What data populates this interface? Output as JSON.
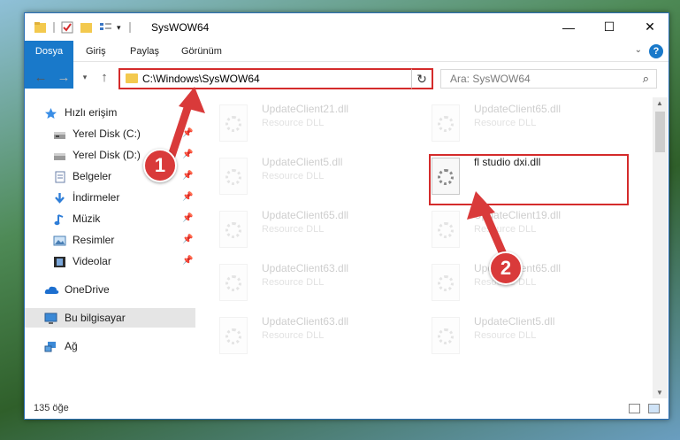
{
  "window": {
    "title": "SysWOW64",
    "controls": {
      "minimize": "—",
      "maximize": "☐",
      "close": "✕"
    }
  },
  "ribbon": {
    "tabs": [
      {
        "label": "Dosya",
        "active": true
      },
      {
        "label": "Giriş"
      },
      {
        "label": "Paylaş"
      },
      {
        "label": "Görünüm"
      }
    ],
    "help": "?"
  },
  "navigation": {
    "address": "C:\\Windows\\SysWOW64",
    "search_placeholder": "Ara: SysWOW64"
  },
  "sidebar": {
    "items": [
      {
        "label": "Hızlı erişim",
        "icon": "star-icon"
      },
      {
        "label": "Yerel Disk (C:)",
        "icon": "drive-icon",
        "pinned": true
      },
      {
        "label": "Yerel Disk (D:)",
        "icon": "drive-icon",
        "pinned": true
      },
      {
        "label": "Belgeler",
        "icon": "documents-icon",
        "pinned": true
      },
      {
        "label": "İndirmeler",
        "icon": "download-icon",
        "pinned": true
      },
      {
        "label": "Müzik",
        "icon": "music-icon",
        "pinned": true
      },
      {
        "label": "Resimler",
        "icon": "pictures-icon",
        "pinned": true
      },
      {
        "label": "Videolar",
        "icon": "videos-icon",
        "pinned": true
      },
      {
        "label": "OneDrive",
        "icon": "cloud-icon"
      },
      {
        "label": "Bu bilgisayar",
        "icon": "computer-icon",
        "selected": true
      },
      {
        "label": "Ağ",
        "icon": "network-icon"
      }
    ]
  },
  "files": [
    {
      "name": "UpdateClient21.dll",
      "type": "Resource DLL"
    },
    {
      "name": "UpdateClient65.dll",
      "type": "Resource DLL"
    },
    {
      "name": "UpdateClient5.dll",
      "type": "Resource DLL"
    },
    {
      "name": "fl studio dxi.dll",
      "type": "",
      "highlighted": true
    },
    {
      "name": "UpdateClient65.dll",
      "type": "Resource DLL"
    },
    {
      "name": "UpdateClient19.dll",
      "type": "Resource DLL"
    },
    {
      "name": "UpdateClient63.dll",
      "type": "Resource DLL"
    },
    {
      "name": "UpdateClient65.dll",
      "type": "Resource DLL"
    },
    {
      "name": "UpdateClient63.dll",
      "type": "Resource DLL"
    },
    {
      "name": "UpdateClient5.dll",
      "type": "Resource DLL"
    }
  ],
  "status": {
    "item_count": "135 öğe"
  },
  "annotations": [
    {
      "number": "1"
    },
    {
      "number": "2"
    }
  ],
  "colors": {
    "accent": "#1979ca",
    "annotation": "#d42b2b"
  }
}
